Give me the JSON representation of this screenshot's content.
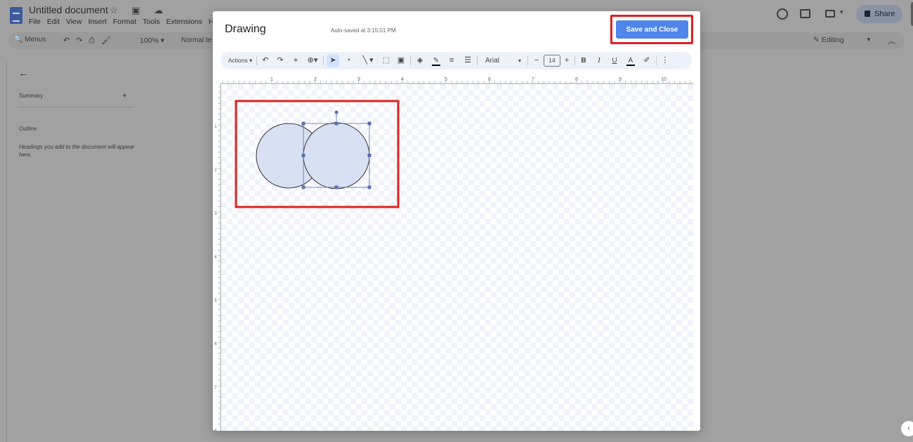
{
  "docs": {
    "title": "Untitled document",
    "title_icons": "☆ ▣ ☁",
    "menu": [
      "File",
      "Edit",
      "View",
      "Insert",
      "Format",
      "Tools",
      "Extensions",
      "H"
    ],
    "share_label": "Share",
    "menus_label": "Menus",
    "toolbar_icons": "↶↷⎙🖌",
    "zoom": "100%",
    "style": "Normal te",
    "mode": "Editing"
  },
  "outline": {
    "summary_label": "Summary",
    "outline_label": "Outline",
    "hint": "Headings you add to the document will appear here."
  },
  "drawing": {
    "title": "Drawing",
    "autosave": "Auto-saved at 3:15:01 PM",
    "save_close_label": "Save and Close",
    "toolbar": {
      "actions": "Actions",
      "font": "Arial",
      "font_size": "14",
      "bold": "B",
      "italic": "I",
      "underline": "U",
      "text_color": "A"
    },
    "ruler_numbers": [
      "1",
      "2",
      "3",
      "4",
      "5",
      "6",
      "7",
      "8",
      "9",
      "10"
    ],
    "left_ruler_numbers": [
      "1",
      "2",
      "3",
      "4",
      "5",
      "6",
      "7",
      "8"
    ],
    "shape_fill": "#d7e1f3",
    "shape_stroke": "#333333",
    "selection_color": "#5b6fb0",
    "highlight_color": "#e02020",
    "accent": "#4e86ea"
  }
}
